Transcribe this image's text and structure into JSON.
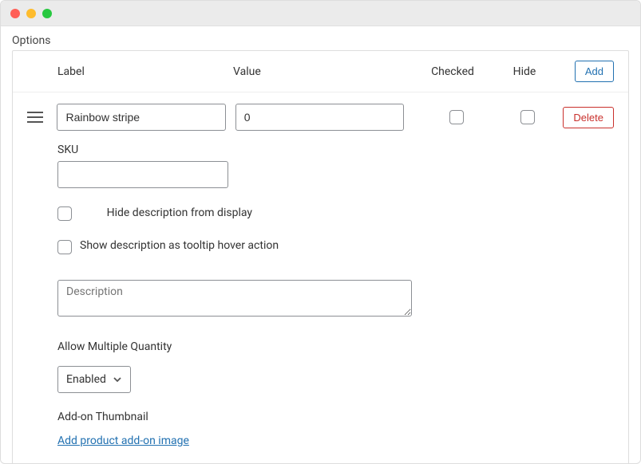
{
  "section_title": "Options",
  "headers": {
    "label": "Label",
    "value": "Value",
    "checked": "Checked",
    "hide": "Hide"
  },
  "buttons": {
    "add": "Add",
    "delete": "Delete"
  },
  "row": {
    "label_value": "Rainbow stripe",
    "value_value": "0",
    "checked": false,
    "hide": false
  },
  "sku": {
    "label": "SKU",
    "value": ""
  },
  "hide_description": {
    "label": "Hide description from display",
    "checked": false
  },
  "tooltip_description": {
    "label": "Show description as tooltip hover action",
    "checked": false
  },
  "description": {
    "placeholder": "Description",
    "value": ""
  },
  "allow_multiple_quantity": {
    "label": "Allow Multiple Quantity",
    "selected": "Enabled"
  },
  "thumbnail": {
    "label": "Add-on Thumbnail",
    "link_text": "Add product add-on image"
  }
}
